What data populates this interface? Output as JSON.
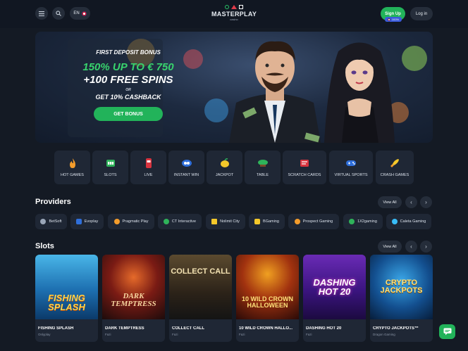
{
  "header": {
    "language": "EN",
    "logo_name": "MASTERPLAY",
    "logo_sub": "casino",
    "signup_label": "Sign Up",
    "signup_badge": "100%",
    "login_label": "Log in"
  },
  "hero": {
    "line1": "FIRST DEPOSIT BONUS",
    "line2": "150% UP TO € 750",
    "line3": "+100 FREE SPINS",
    "line4": "OR",
    "line5": "GET 10% CASHBACK",
    "cta": "GET BONUS"
  },
  "categories": [
    {
      "label": "HOT GAMES",
      "icon": "flame-icon"
    },
    {
      "label": "SLOTS",
      "icon": "slot-machine-icon"
    },
    {
      "label": "LIVE",
      "icon": "live-icon"
    },
    {
      "label": "INSTANT WIN",
      "icon": "coins-icon"
    },
    {
      "label": "JACKPOT",
      "icon": "lemon-icon"
    },
    {
      "label": "TABLE",
      "icon": "table-icon"
    },
    {
      "label": "SCRATCH CARDS",
      "icon": "scratch-card-icon"
    },
    {
      "label": "VIRTUAL SPORTS",
      "icon": "gamepad-icon"
    },
    {
      "label": "CRASH GAMES",
      "icon": "rocket-icon"
    }
  ],
  "providers": {
    "title": "Providers",
    "view_all": "View All",
    "items": [
      "BetSoft",
      "Evoplay",
      "Pragmatic Play",
      "CT Interactive",
      "Nolimit City",
      "BGaming",
      "Prospect Gaming",
      "1X2gaming",
      "Caleta Gaming"
    ]
  },
  "slots": {
    "title": "Slots",
    "view_all": "View All",
    "games": [
      {
        "name": "FISHING SPLASH",
        "provider": "Onlyplay",
        "art": "FISHING SPLASH"
      },
      {
        "name": "DARK TEMPTRESS",
        "provider": "Fazi",
        "art": "DARK TEMPTRESS"
      },
      {
        "name": "COLLECT CALL",
        "provider": "Fazi",
        "art": "COLLECT CALL"
      },
      {
        "name": "10 WILD CROWN HALLO...",
        "provider": "Fazi",
        "art": "10 WILD CROWN HALLOWEEN"
      },
      {
        "name": "DASHING HOT 20",
        "provider": "Fazi",
        "art": "DASHING HOT 20"
      },
      {
        "name": "CRYPTO JACKPOTS™",
        "provider": "Dragon Gaming",
        "art": "CRYPTO JACKPOTS"
      }
    ]
  },
  "colors": {
    "accent": "#22b35a",
    "background": "#141a24",
    "card": "#1f2735"
  }
}
